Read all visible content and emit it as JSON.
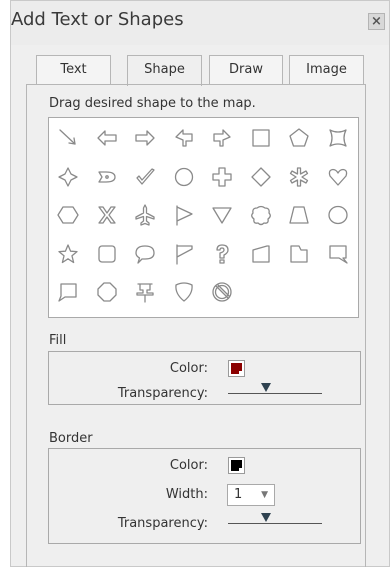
{
  "title": "Add Text or Shapes",
  "close_label": "×",
  "tabs": [
    {
      "label": "Text",
      "active": false
    },
    {
      "label": "Shape",
      "active": true
    },
    {
      "label": "Draw",
      "active": false
    },
    {
      "label": "Image",
      "active": false
    }
  ],
  "instruction": "Drag desired shape to the map.",
  "shapes": [
    "line-arrow",
    "arrow-left",
    "arrow-right",
    "arrow-up-left",
    "arrow-up-right",
    "rectangle",
    "pentagon",
    "concave-square",
    "four-point-star",
    "callout-shape",
    "checkmark",
    "circle",
    "cross",
    "diamond",
    "asterisk",
    "heart",
    "hexagon",
    "x-shape",
    "airplane",
    "flag-pennant",
    "triangle-down",
    "cloud",
    "trapezoid",
    "ellipse",
    "star",
    "rounded-square",
    "speech-bubble",
    "flag",
    "question-mark",
    "parallelogram-right",
    "tab-shape",
    "callout-square",
    "callout-left",
    "octagon",
    "push-pin",
    "shield",
    "no-symbol"
  ],
  "fill": {
    "section_label": "Fill",
    "color_label": "Color:",
    "color": "#8b0000",
    "transparency_label": "Transparency:",
    "transparency_value": 0.4
  },
  "border": {
    "section_label": "Border",
    "color_label": "Color:",
    "color": "#000000",
    "width_label": "Width:",
    "width_value": "1",
    "transparency_label": "Transparency:",
    "transparency_value": 0.4
  }
}
